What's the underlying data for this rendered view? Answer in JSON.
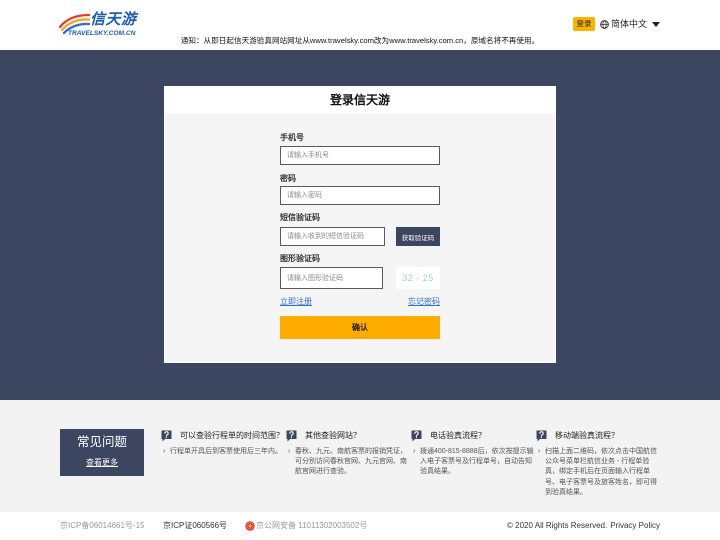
{
  "header": {
    "logo_text": "信天游",
    "logo_sub": "TRAVELSKY.COM.CN",
    "login_badge": "登录",
    "language": "简体中文",
    "language_icon": "globe-icon",
    "language_dropdown_icon": "caret-down-icon",
    "notice": "通知：从即日起信天游验真网站网址从www.travelsky.com改为www.travelsky.com.cn，原域名将不再使用。"
  },
  "login": {
    "title": "登录信天游",
    "phone": {
      "label": "手机号",
      "placeholder": "请输入手机号"
    },
    "password": {
      "label": "密码",
      "placeholder": "请输入密码"
    },
    "sms_code": {
      "label": "短信验证码",
      "placeholder": "请输入收到的短信验证码",
      "button": "获取验证码"
    },
    "captcha": {
      "label": "图形验证码",
      "placeholder": "请输入图形验证码",
      "image_text": "32 - 25"
    },
    "register_link": "立即注册",
    "forgot_link": "忘记密码",
    "submit": "确认"
  },
  "faq": {
    "heading": "常见问题",
    "more_link": "查看更多",
    "item_icon": "question-bubble-icon",
    "items": [
      {
        "title": "可以查验行程单的时间范围？",
        "text": "行程单开具后到客票使用后三年内。"
      },
      {
        "title": "其他查验网站？",
        "text": "春秋、九元、南航客票的报销凭证，可分别访问春秋官网、九元官网、南航官网进行查验。"
      },
      {
        "title": "电话验真流程？",
        "text": "拨通400-815-8888后，依次按提示输入电子客票号及行程单号，自动告知验真结果。"
      },
      {
        "title": "移动端验真流程？",
        "text": "扫描上面二维码，依次点击中国航信公众号菜单栏航信业务 - 行程单验真，绑定手机后在页面输入行程单号、电子客票号及旅客姓名，即可得到验真结果。"
      }
    ]
  },
  "footer": {
    "icp_record": "京ICP备06014661号-15",
    "icp_license": "京ICP证060566号",
    "police_icon": "police-emblem-icon",
    "police_record": "京公网安备 11011302003502号",
    "copyright": "©  2020 All Rights Reserved.",
    "privacy_link": "Privacy Policy"
  },
  "colors": {
    "navy": "#3d4660",
    "accent_orange": "#ffac00",
    "link_blue": "#2f6fd3",
    "faq_background": "#f3f3f3",
    "card_body": "#f5f5f5"
  }
}
